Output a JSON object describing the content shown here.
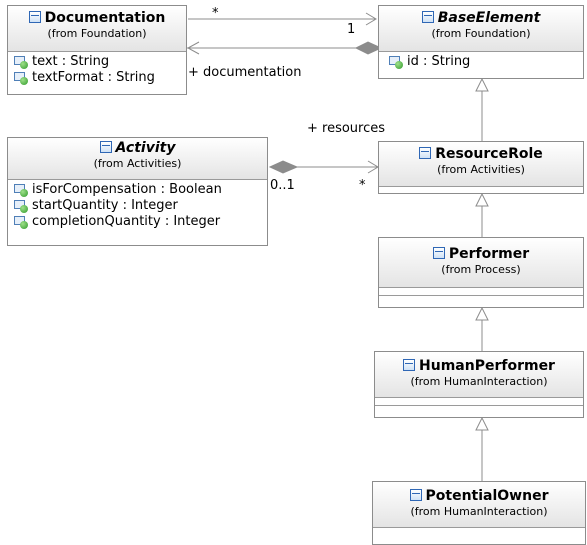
{
  "classes": {
    "documentation": {
      "name": "Documentation",
      "from": "(from Foundation)",
      "attributes": [
        "text : String",
        "textFormat : String"
      ]
    },
    "base_element": {
      "name": "BaseElement",
      "from": "(from Foundation)",
      "attributes": [
        "id : String"
      ]
    },
    "activity": {
      "name": "Activity",
      "from": "(from Activities)",
      "attributes": [
        "isForCompensation : Boolean",
        "startQuantity : Integer",
        "completionQuantity : Integer"
      ]
    },
    "resource_role": {
      "name": "ResourceRole",
      "from": "(from Activities)"
    },
    "performer": {
      "name": "Performer",
      "from": "(from Process)"
    },
    "human_performer": {
      "name": "HumanPerformer",
      "from": "(from HumanInteraction)"
    },
    "potential_owner": {
      "name": "PotentialOwner",
      "from": "(from HumanInteraction)"
    }
  },
  "associations": {
    "documentation": {
      "role": "+ documentation",
      "source_multiplicity": "*",
      "target_multiplicity": "1"
    },
    "resources": {
      "role": "+ resources",
      "source_multiplicity": "0..1",
      "target_multiplicity": "*"
    }
  }
}
